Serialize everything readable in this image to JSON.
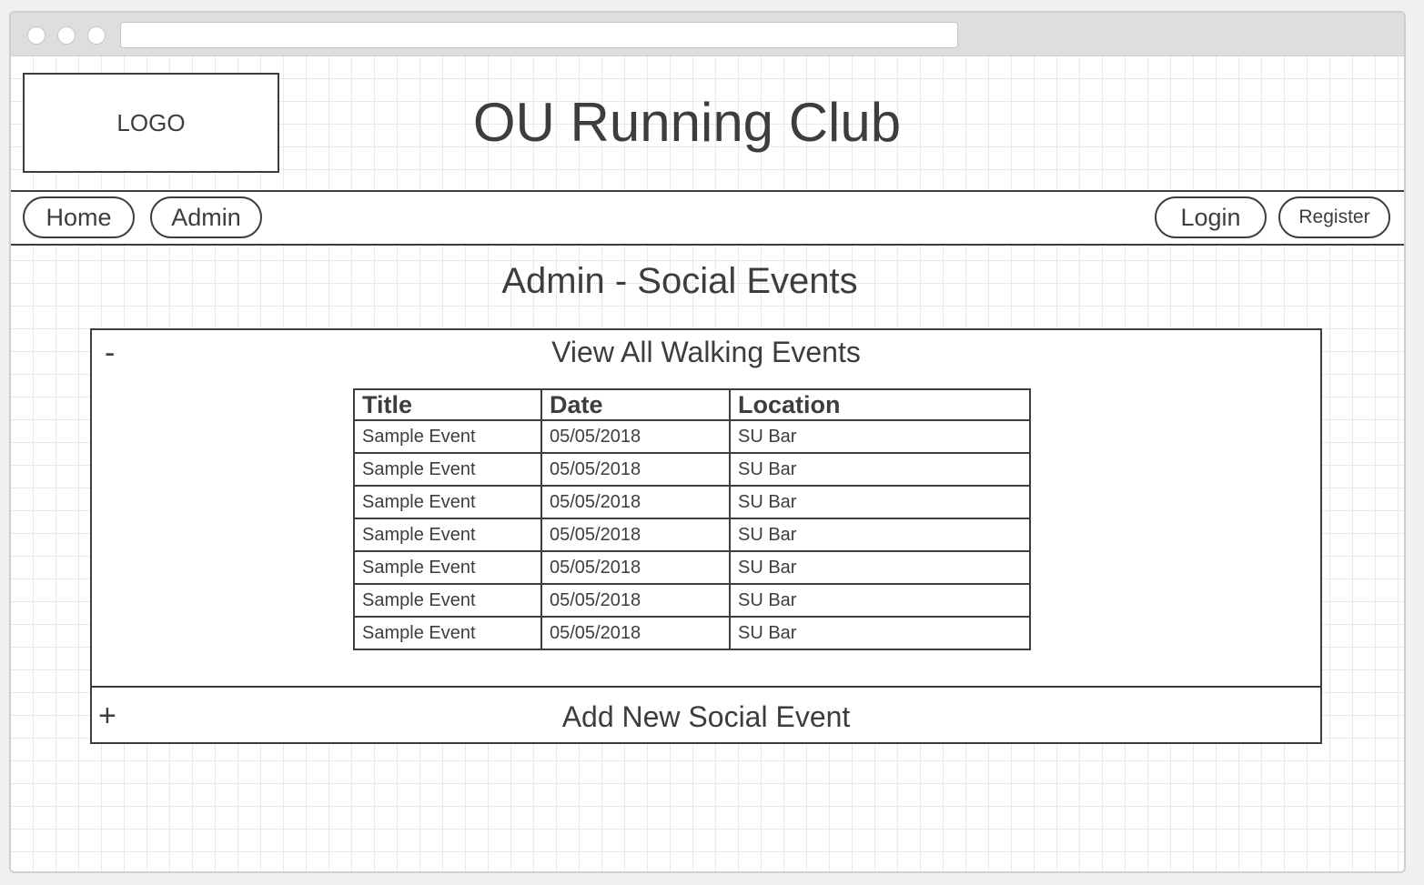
{
  "site": {
    "logo_text": "LOGO",
    "title": "OU Running Club"
  },
  "nav": {
    "home": "Home",
    "admin": "Admin",
    "login": "Login",
    "register": "Register"
  },
  "page": {
    "heading": "Admin - Social Events"
  },
  "events_panel": {
    "toggle": "-",
    "title": "View All Walking Events",
    "columns": [
      "Title",
      "Date",
      "Location"
    ],
    "rows": [
      [
        "Sample Event",
        "05/05/2018",
        "SU Bar"
      ],
      [
        "Sample Event",
        "05/05/2018",
        "SU Bar"
      ],
      [
        "Sample Event",
        "05/05/2018",
        "SU Bar"
      ],
      [
        "Sample Event",
        "05/05/2018",
        "SU Bar"
      ],
      [
        "Sample Event",
        "05/05/2018",
        "SU Bar"
      ],
      [
        "Sample Event",
        "05/05/2018",
        "SU Bar"
      ],
      [
        "Sample Event",
        "05/05/2018",
        "SU Bar"
      ]
    ]
  },
  "add_panel": {
    "toggle": "+",
    "title": "Add New Social Event"
  }
}
